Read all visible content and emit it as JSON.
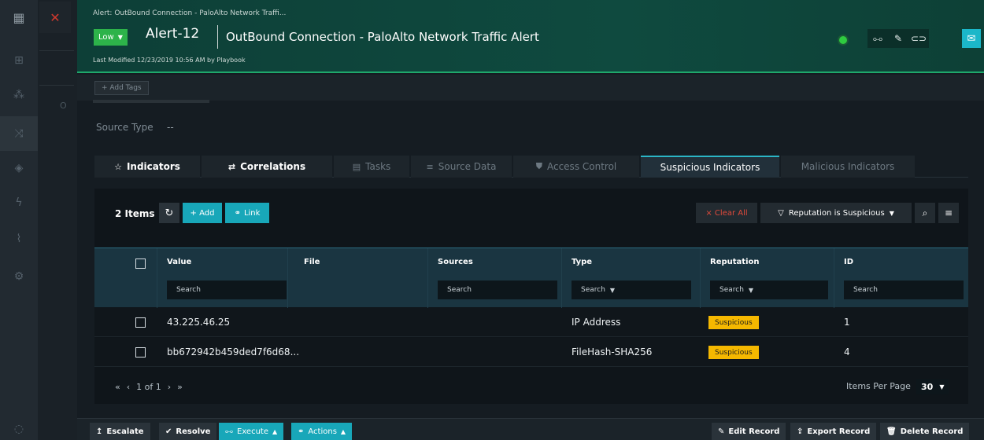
{
  "header": {
    "breadcrumb": "Alert: OutBound Connection - PaloAlto Network Traffi...",
    "severity": "Low",
    "alert_id": "Alert-12",
    "title": "OutBound Connection - PaloAlto Network Traffic Alert",
    "last_modified": "Last Modified 12/23/2019 10:56 AM by Playbook"
  },
  "tags": {
    "add_label": "+ Add Tags"
  },
  "source_type": {
    "label": "Source Type",
    "value": "--"
  },
  "tabs": [
    {
      "label": "Indicators",
      "icon": "star-icon"
    },
    {
      "label": "Correlations",
      "icon": "swap-icon"
    },
    {
      "label": "Tasks",
      "icon": "tasks-icon"
    },
    {
      "label": "Source Data",
      "icon": "database-icon"
    },
    {
      "label": "Access Control",
      "icon": "shield-icon"
    },
    {
      "label": "Suspicious Indicators",
      "icon": ""
    },
    {
      "label": "Malicious Indicators",
      "icon": ""
    }
  ],
  "grid": {
    "count": "2 Items",
    "add_label": "+ Add",
    "link_label": "Link",
    "clear_all": "× Clear All",
    "filter_label": "Reputation is Suspicious",
    "columns": [
      {
        "label": "Value",
        "search": "Search"
      },
      {
        "label": "File",
        "search": ""
      },
      {
        "label": "Sources",
        "search": "Search"
      },
      {
        "label": "Type",
        "search": "Search"
      },
      {
        "label": "Reputation",
        "search": "Search"
      },
      {
        "label": "ID",
        "search": "Search"
      }
    ],
    "rows": [
      {
        "value": "43.225.46.25",
        "type": "IP Address",
        "reputation": "Suspicious",
        "id": "1"
      },
      {
        "value": "bb672942b459ded7f6d68...",
        "type": "FileHash-SHA256",
        "reputation": "Suspicious",
        "id": "4"
      }
    ],
    "pager": {
      "range": "1 of 1",
      "items_per_page_label": "Items Per Page",
      "items_per_page": "30"
    }
  },
  "footer": {
    "escalate": "Escalate",
    "resolve": "Resolve",
    "execute": "Execute",
    "actions": "Actions",
    "edit_record": "Edit Record",
    "export_record": "Export Record",
    "delete_record": "Delete Record"
  },
  "colors": {
    "accent": "#18a7b9",
    "severity_low": "#2db34a",
    "suspicious": "#f5b800",
    "danger": "#e04a3b"
  }
}
